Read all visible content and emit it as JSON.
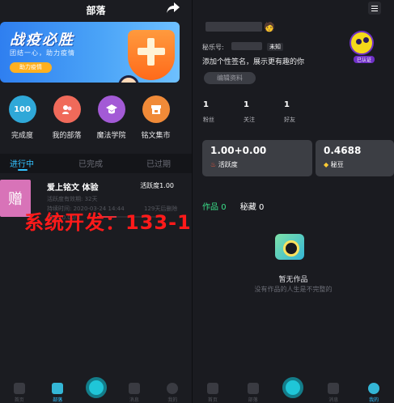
{
  "left": {
    "header_title": "部落",
    "banner": {
      "title": "战疫必胜",
      "subtitle": "团结一心，助力疫情",
      "button": "助力疫情"
    },
    "shortcuts": [
      {
        "label": "完成度",
        "icon_text": "100",
        "color": "#2fa8d8"
      },
      {
        "label": "我的部落",
        "icon_text": "",
        "color": "#f06a5a"
      },
      {
        "label": "魔法学院",
        "icon_text": "",
        "color": "#a35ad6"
      },
      {
        "label": "铭文集市",
        "icon_text": "",
        "color": "#f08a38"
      }
    ],
    "tabs": [
      "进行中",
      "已完成",
      "已过期"
    ],
    "card": {
      "gift": "赠",
      "title": "爱上铭文 体验",
      "active": "活跃度1.00",
      "line1": "活跃度有效期: 32天",
      "line2": "持续时间: 2020-03-24 14:44",
      "line3": "129天后删除",
      "progress_label": "进度: 0.00/3",
      "progress": 0.3
    },
    "watermark": "系统开发：133-1612-4787"
  },
  "nav": {
    "items": [
      "首页",
      "部落",
      "",
      "消息",
      "我的"
    ]
  },
  "right": {
    "id_label": "秘乐号:",
    "id_badge": "未知",
    "signature": "添加个性签名，展示更有趣的你",
    "edit": "编辑资料",
    "avatar_tag": "已认证",
    "stats": [
      {
        "value": "1",
        "label": "粉丝"
      },
      {
        "value": "1",
        "label": "关注"
      },
      {
        "value": "1",
        "label": "好友"
      }
    ],
    "cards": [
      {
        "value": "1.00+0.00",
        "label": "活跃度"
      },
      {
        "value": "0.4688",
        "label": "秘豆"
      }
    ],
    "works_label": "作品",
    "works_count": "0",
    "fav_label": "秘藏",
    "fav_count": "0",
    "empty_title": "暂无作品",
    "empty_sub": "没有作品的人生是不完整的"
  }
}
